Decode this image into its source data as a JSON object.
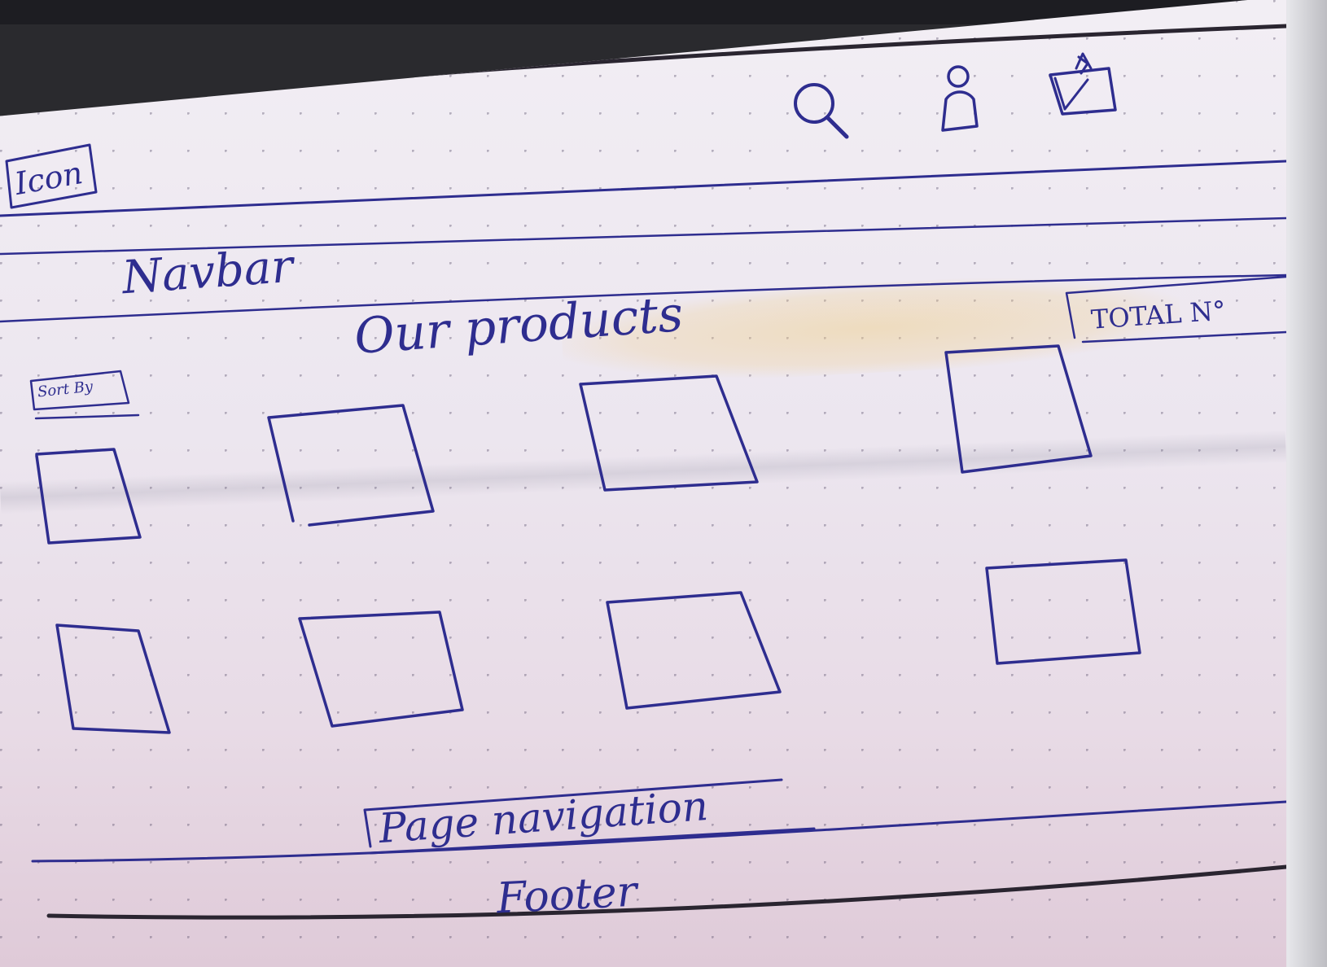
{
  "header": {
    "logo_label": "Icon",
    "icons": [
      "search-icon",
      "user-icon",
      "cart-icon"
    ]
  },
  "navbar": {
    "label": "Navbar"
  },
  "products_section": {
    "title": "Our products",
    "sort_label": "Sort By",
    "total_label": "TOTAL N°",
    "product_rows": 2,
    "products_per_row": 4
  },
  "pagination": {
    "label": "Page navigation"
  },
  "footer": {
    "label": "Footer"
  },
  "colors": {
    "ink": "#2e2d8f",
    "rule": "#2a2530",
    "paper": "#ece6ef"
  }
}
